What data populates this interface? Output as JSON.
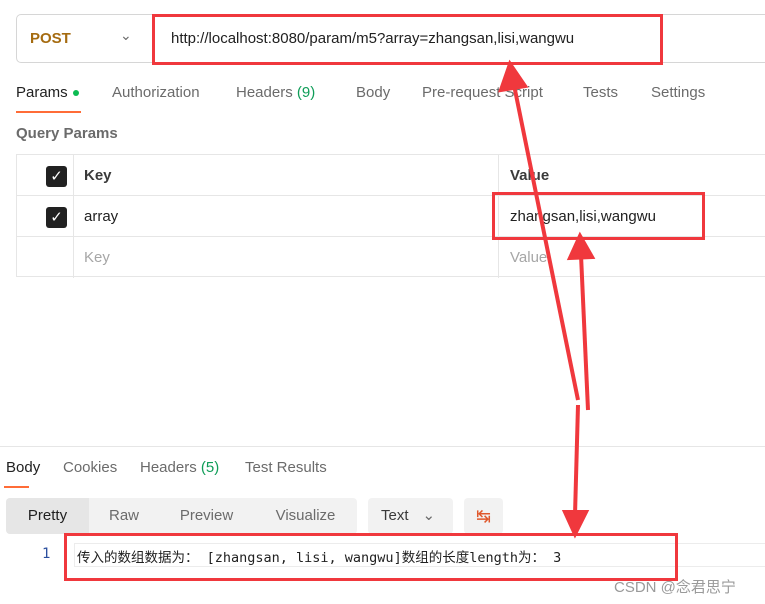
{
  "request": {
    "method": "POST",
    "url": "http://localhost:8080/param/m5?array=zhangsan,lisi,wangwu"
  },
  "request_tabs": [
    {
      "label": "Params"
    },
    {
      "label": "Authorization"
    },
    {
      "label": "Headers ",
      "count": "(9)"
    },
    {
      "label": "Body"
    },
    {
      "label": "Pre-request Script"
    },
    {
      "label": "Tests"
    },
    {
      "label": "Settings"
    }
  ],
  "query_params": {
    "title": "Query Params",
    "header": {
      "key": "Key",
      "value": "Value"
    },
    "rows": [
      {
        "checked": true,
        "key": "array",
        "value": "zhangsan,lisi,wangwu"
      }
    ],
    "placeholder": {
      "key": "Key",
      "value": "Value"
    }
  },
  "response_tabs": [
    {
      "label": "Body"
    },
    {
      "label": "Cookies"
    },
    {
      "label": "Headers ",
      "count": "(5)"
    },
    {
      "label": "Test Results"
    }
  ],
  "view_modes": [
    "Pretty",
    "Raw",
    "Preview",
    "Visualize"
  ],
  "format": "Text",
  "response_body": {
    "line_number": "1",
    "text": "传入的数组数据为： [zhangsan, lisi, wangwu]数组的长度length为： 3"
  },
  "watermark": "CSDN @念君思宁",
  "colors": {
    "accent": "#ff6c37",
    "annotation": "#f0383d",
    "method": "#a56b10"
  }
}
